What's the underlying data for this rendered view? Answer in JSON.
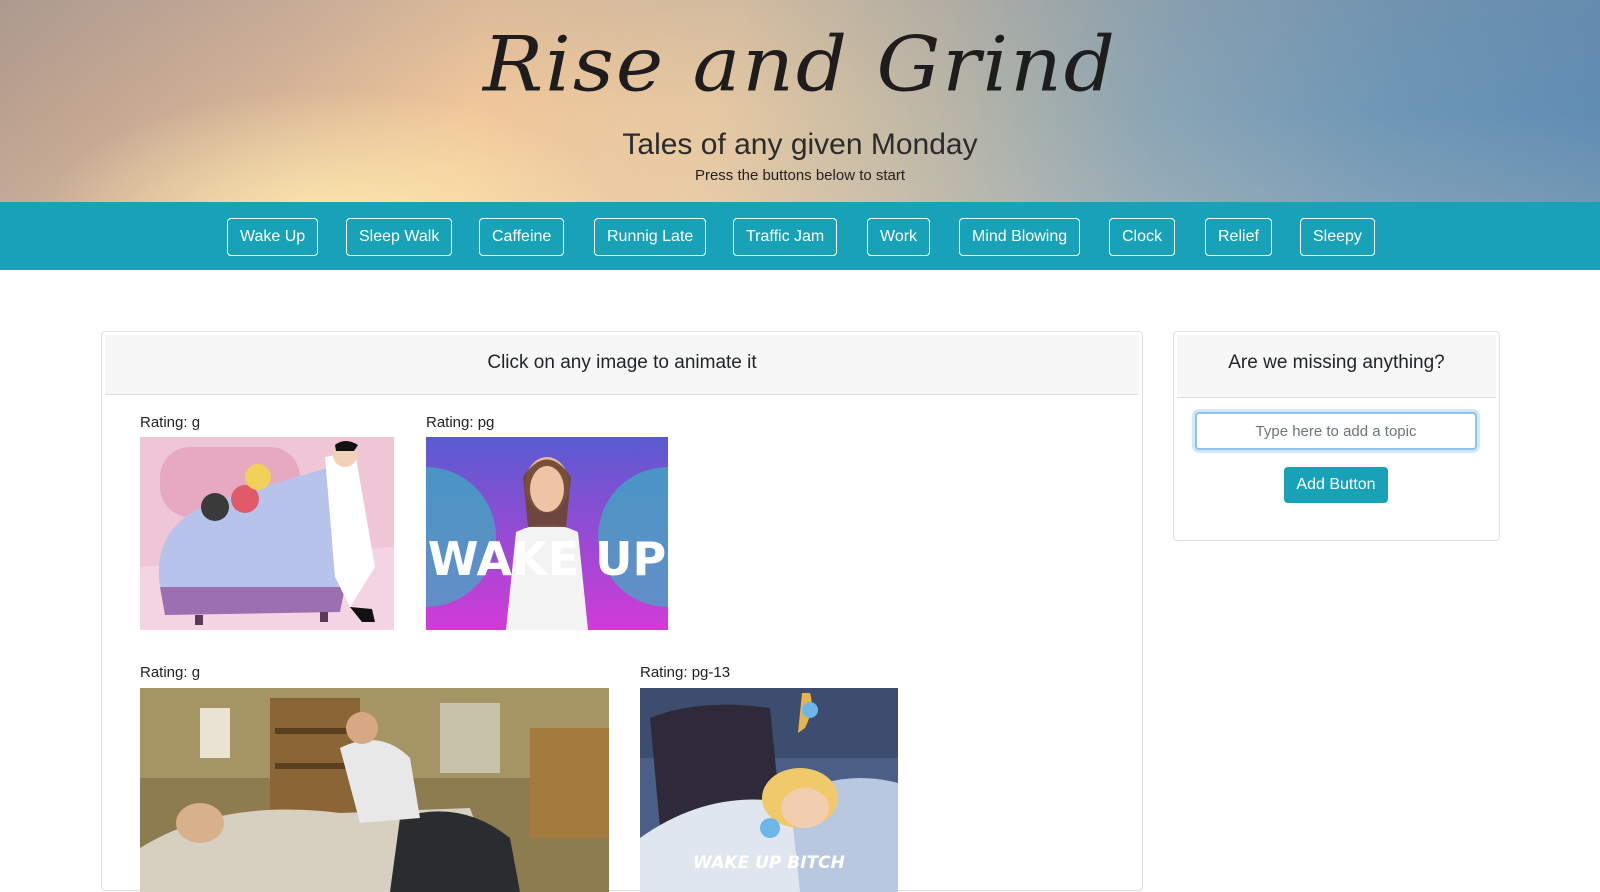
{
  "header": {
    "title": "Rise and Grind",
    "tagline": "Tales of any given Monday",
    "subtitle": "Press the buttons below to start"
  },
  "topics": [
    "Wake Up",
    "Sleep Walk",
    "Caffeine",
    "Runnig Late",
    "Traffic Jam",
    "Work",
    "Mind Blowing",
    "Clock",
    "Relief",
    "Sleepy"
  ],
  "results": {
    "header": "Click on any image to animate it",
    "items": [
      {
        "rating": "Rating: g",
        "caption": ""
      },
      {
        "rating": "Rating: pg",
        "caption": "WAKE UP"
      },
      {
        "rating": "Rating: g",
        "caption": ""
      },
      {
        "rating": "Rating: pg-13",
        "caption": "WAKE UP BITCH"
      }
    ]
  },
  "sidebar": {
    "header": "Are we missing anything?",
    "input_placeholder": "Type here to add a topic",
    "add_button": "Add Button"
  },
  "colors": {
    "accent": "#17a2b8",
    "card_header_bg": "#f7f7f7"
  }
}
